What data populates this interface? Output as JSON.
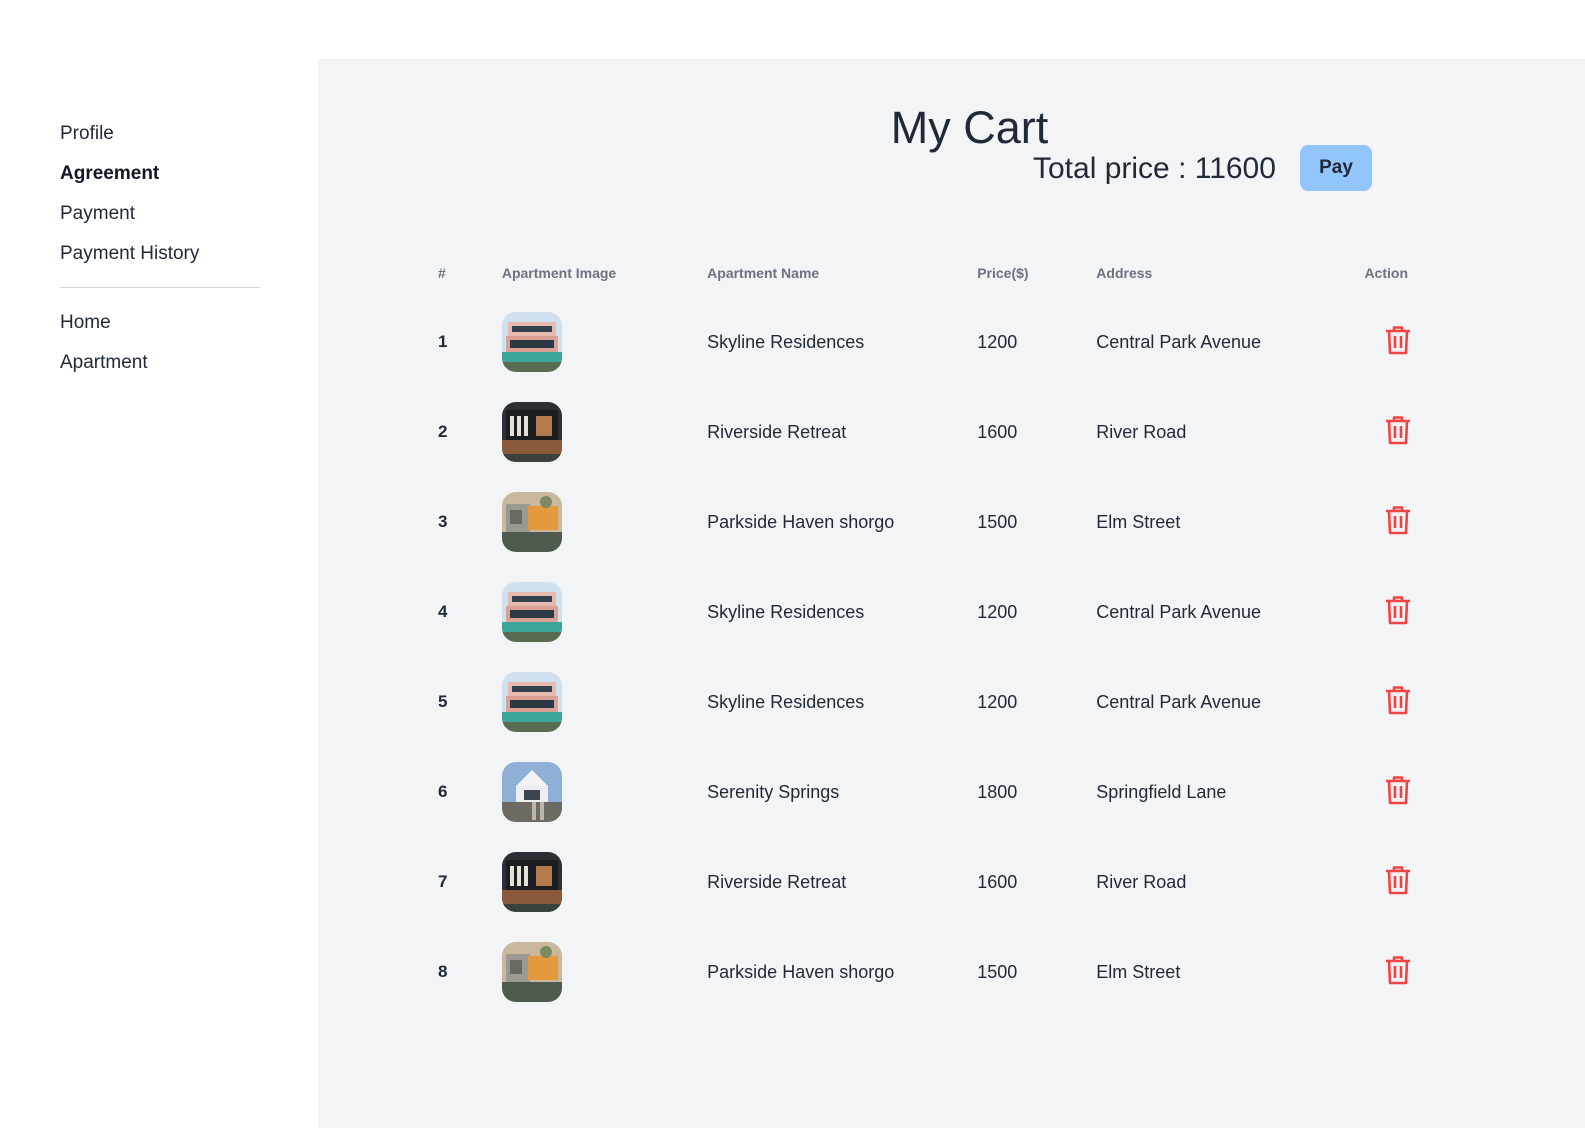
{
  "sidebar": {
    "items": [
      {
        "label": "Profile",
        "active": false
      },
      {
        "label": "Agreement",
        "active": true
      },
      {
        "label": "Payment",
        "active": false
      },
      {
        "label": "Payment History",
        "active": false
      }
    ],
    "secondary_items": [
      {
        "label": "Home"
      },
      {
        "label": "Apartment"
      }
    ]
  },
  "cart": {
    "title": "My Cart",
    "total_label": "Total price : 11600",
    "pay_label": "Pay"
  },
  "table": {
    "headers": [
      "#",
      "Apartment Image",
      "Apartment Name",
      "Price($)",
      "Address",
      "Action"
    ],
    "rows": [
      {
        "index": "1",
        "image": "pink-villa-pool",
        "name": "Skyline Residences",
        "price": "1200",
        "address": "Central Park Avenue"
      },
      {
        "index": "2",
        "image": "dark-modern-house",
        "name": "Riverside Retreat",
        "price": "1600",
        "address": "River Road"
      },
      {
        "index": "3",
        "image": "sunset-cube-house",
        "name": "Parkside Haven shorgo",
        "price": "1500",
        "address": "Elm Street"
      },
      {
        "index": "4",
        "image": "pink-villa-pool",
        "name": "Skyline Residences",
        "price": "1200",
        "address": "Central Park Avenue"
      },
      {
        "index": "5",
        "image": "pink-villa-pool",
        "name": "Skyline Residences",
        "price": "1200",
        "address": "Central Park Avenue"
      },
      {
        "index": "6",
        "image": "white-gable-house",
        "name": "Serenity Springs",
        "price": "1800",
        "address": "Springfield Lane"
      },
      {
        "index": "7",
        "image": "dark-modern-house",
        "name": "Riverside Retreat",
        "price": "1600",
        "address": "River Road"
      },
      {
        "index": "8",
        "image": "sunset-cube-house",
        "name": "Parkside Haven shorgo",
        "price": "1500",
        "address": "Elm Street"
      }
    ]
  },
  "colors": {
    "main_bg": "#f3f4f6",
    "pay_button": "#93c5fd",
    "delete_icon": "#ef4444"
  }
}
